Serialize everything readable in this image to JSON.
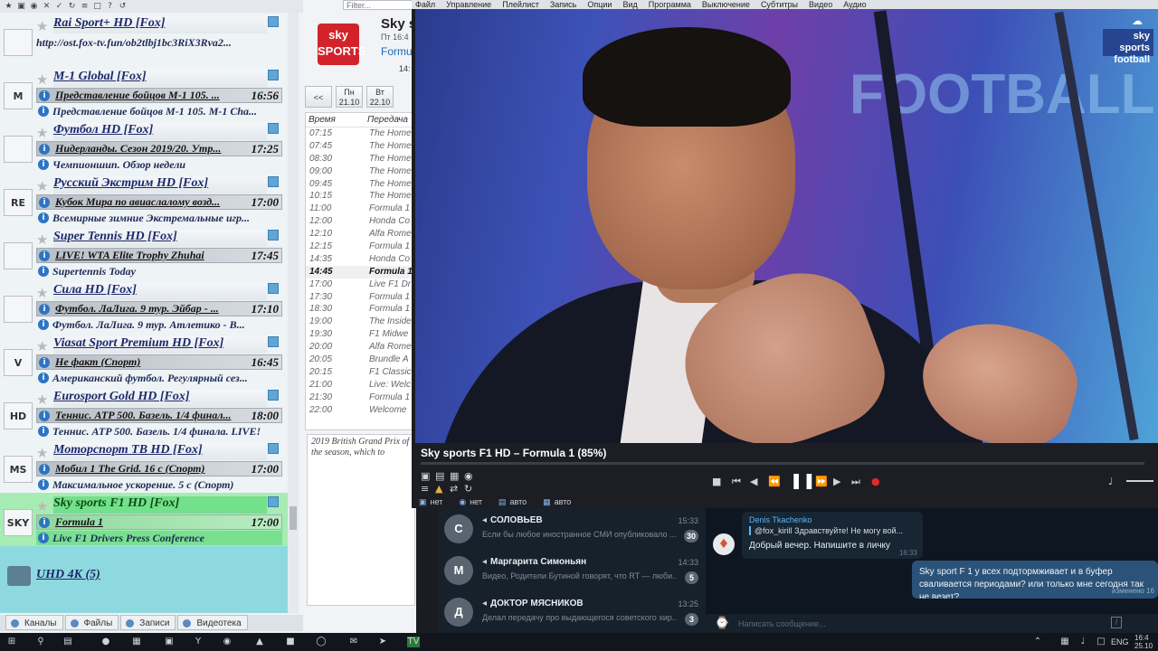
{
  "left_toolbar": {
    "icons": [
      "★",
      "▣",
      "◉",
      "✕",
      "✓",
      "↻",
      "≡",
      "□",
      "?",
      "↺"
    ]
  },
  "channels": [
    {
      "name": "Rai Sport+ HD [Fox]",
      "url": "http://ost.fox-tv.fun/ob2tlbj1bc3RiX3Rva2...",
      "logo": ""
    },
    {
      "name": "M-1 Global [Fox]",
      "now": "Представление бойцов M-1 105. ...",
      "now_time": "16:56",
      "next": "Представление бойцов M-1 105. M-1 Cha...",
      "logo": "M"
    },
    {
      "name": "Футбол HD [Fox]",
      "now": "Нидерланды. Сезон 2019/20. Утр...",
      "now_time": "17:25",
      "next": "Чемпионшип. Обзор недели",
      "logo": ""
    },
    {
      "name": "Русский Экстрим HD [Fox]",
      "now": "Кубок Мира по авиаслалому возд...",
      "now_time": "17:00",
      "next": "Всемирные зимние Экстремальные игр...",
      "logo": "RE"
    },
    {
      "name": "Super Tennis HD [Fox]",
      "now": "LIVE! WTA Elite Trophy Zhuhai",
      "now_time": "17:45",
      "next": "Supertennis Today",
      "logo": ""
    },
    {
      "name": "Сила HD [Fox]",
      "now": "Футбол. ЛаЛига. 9 тур. Эйбар - ...",
      "now_time": "17:10",
      "next": "Футбол. ЛаЛига. 9 тур. Атлетико - В...",
      "logo": ""
    },
    {
      "name": "Viasat Sport Premium HD [Fox]",
      "now": "Не факт (Спорт)",
      "now_time": "16:45",
      "next": "Американский футбол. Регулярный сез...",
      "logo": "V"
    },
    {
      "name": "Eurosport Gold HD [Fox]",
      "now": "Теннис. ATP 500. Базель. 1/4 финал...",
      "now_time": "18:00",
      "next": "Теннис. ATP 500. Базель. 1/4 финала. LIVE!",
      "logo": "HD"
    },
    {
      "name": "Моторспорт ТВ HD [Fox]",
      "now": "Мобил 1 The Grid. 16 с (Спорт)",
      "now_time": "17:00",
      "next": "Максимальное ускорение. 5 с (Спорт)",
      "logo": "MS"
    },
    {
      "name": "Sky sports F1 HD [Fox]",
      "now": "Formula 1",
      "now_time": "17:00",
      "next": "Live F1 Drivers Press Conference",
      "logo": "SKY"
    }
  ],
  "uhd_group": {
    "label": "UHD 4K (5)"
  },
  "left_tabs": [
    "Каналы",
    "Файлы",
    "Записи",
    "Видеотека"
  ],
  "epg": {
    "filter_placeholder": "Filter...",
    "logo_text": "sky SPORTS",
    "title": "Sky s",
    "date": "Пт 16:4",
    "program": "Formula",
    "time": "14:",
    "nav_prev": "<<",
    "days": [
      {
        "name": "Пн",
        "date": "21.10"
      },
      {
        "name": "Вт",
        "date": "22.10"
      }
    ],
    "col_time": "Время",
    "col_show": "Передача",
    "rows": [
      {
        "t": "07:15",
        "s": "The Home"
      },
      {
        "t": "07:45",
        "s": "The Home"
      },
      {
        "t": "08:30",
        "s": "The Home"
      },
      {
        "t": "09:00",
        "s": "The Home"
      },
      {
        "t": "09:45",
        "s": "The Home"
      },
      {
        "t": "10:15",
        "s": "The Home"
      },
      {
        "t": "11:00",
        "s": "Formula 1"
      },
      {
        "t": "12:00",
        "s": "Honda Co"
      },
      {
        "t": "12:10",
        "s": "Alfa Rome"
      },
      {
        "t": "12:15",
        "s": "Formula 1"
      },
      {
        "t": "14:35",
        "s": "Honda Co"
      },
      {
        "t": "14:45",
        "s": "Formula 1",
        "current": true
      },
      {
        "t": "17:00",
        "s": "Live F1 Dr"
      },
      {
        "t": "17:30",
        "s": "Formula 1"
      },
      {
        "t": "18:30",
        "s": "Formula 1"
      },
      {
        "t": "19:00",
        "s": "The Inside"
      },
      {
        "t": "19:30",
        "s": "F1 Midwe"
      },
      {
        "t": "20:00",
        "s": "Alfa Rome"
      },
      {
        "t": "20:05",
        "s": "Brundle A"
      },
      {
        "t": "20:15",
        "s": "F1 Classic"
      },
      {
        "t": "21:00",
        "s": "Live: Welc"
      },
      {
        "t": "21:30",
        "s": "Formula 1"
      },
      {
        "t": "22:00",
        "s": "Welcome"
      }
    ],
    "description": "2019 British Grand Prix of the season, which to"
  },
  "player": {
    "menu": [
      "Файл",
      "Управление",
      "Плейлист",
      "Запись",
      "Опции",
      "Вид",
      "Программа",
      "Выключение",
      "Субтитры",
      "Видео",
      "Аудио"
    ],
    "studio_text": "FOOTBALL",
    "channel_bug": "sky sports football",
    "title": "Sky sports F1 HD – Formula 1 (85%)",
    "progress_pct": 0,
    "status": [
      {
        "icon": "▣",
        "label": "нет"
      },
      {
        "icon": "◉",
        "label": "нет"
      },
      {
        "icon": "▤",
        "label": "авто"
      },
      {
        "icon": "▦",
        "label": "авто"
      }
    ]
  },
  "messenger": {
    "chats": [
      {
        "name": "СОЛОВЬЕВ",
        "time": "15:33",
        "preview": "Если бы любое иностранное СМИ опубликовало ...",
        "badge": "30",
        "avatar": "С"
      },
      {
        "name": "Маргарита Симоньян",
        "time": "14:33",
        "preview": "Видео, Родители Бутиной говорят, что RT — люби...",
        "badge": "5",
        "avatar": "М"
      },
      {
        "name": "ДОКТОР МЯСНИКОВ",
        "time": "13:25",
        "preview": "Делал передачу про выдающегося советского хир...",
        "badge": "3",
        "avatar": "Д"
      }
    ],
    "incoming": {
      "author": "Denis Tkachenko",
      "quote": "@fox_kirill Здравствуйте! Не могу вой...",
      "text": "Добрый вечер. Напишите в личку",
      "time": "16:33"
    },
    "outgoing": {
      "text": "Sky sport F 1 у всех подтормживает и в буфер сваливается периодами? или только мне сегодня так не везет?",
      "status": "изменено 16"
    },
    "compose_placeholder": "Написать сообщение..."
  },
  "taskbar": {
    "lang": "ENG",
    "time": "16:4",
    "date": "25.10"
  }
}
